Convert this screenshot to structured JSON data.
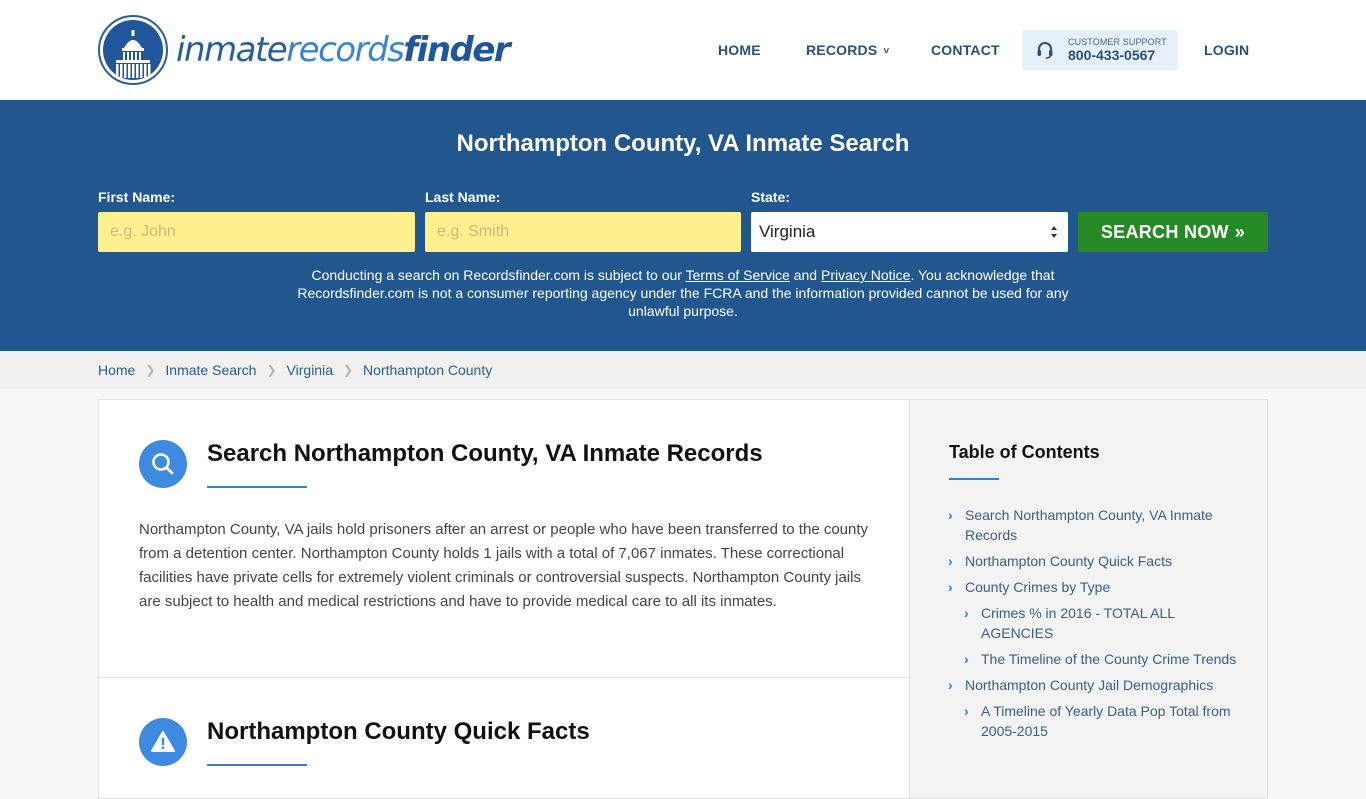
{
  "header": {
    "logo": {
      "part1": "inmate",
      "part2": "records",
      "part3": "finder"
    },
    "nav": {
      "home": "HOME",
      "records": "RECORDS",
      "contact": "CONTACT",
      "login": "LOGIN"
    },
    "support": {
      "label": "CUSTOMER SUPPORT",
      "phone": "800-433-0567"
    }
  },
  "hero": {
    "title": "Northampton County, VA Inmate Search",
    "first_name_label": "First Name:",
    "first_name_placeholder": "e.g. John",
    "first_name_value": "",
    "last_name_label": "Last Name:",
    "last_name_placeholder": "e.g. Smith",
    "last_name_value": "",
    "state_label": "State:",
    "state_value": "Virginia",
    "search_button": "SEARCH NOW",
    "disclaimer": {
      "part1": "Conducting a search on Recordsfinder.com is subject to our ",
      "terms_link": "Terms of Service",
      "part2": " and ",
      "privacy_link": "Privacy Notice",
      "part3": ". You acknowledge that Recordsfinder.com is not a consumer reporting agency under the FCRA and the information provided cannot be used for any unlawful purpose."
    }
  },
  "breadcrumb": {
    "items": [
      "Home",
      "Inmate Search",
      "Virginia",
      "Northampton County"
    ]
  },
  "main": {
    "sections": [
      {
        "icon": "search-icon",
        "title": "Search Northampton County, VA Inmate Records",
        "body": "Northampton County, VA jails hold prisoners after an arrest or people who have been transferred to the county from a detention center. Northampton County holds 1 jails with a total of 7,067 inmates. These correctional facilities have private cells for extremely violent criminals or controversial suspects. Northampton County jails are subject to health and medical restrictions and have to provide medical care to all its inmates."
      },
      {
        "icon": "warning-icon",
        "title": "Northampton County Quick Facts"
      }
    ]
  },
  "toc": {
    "title": "Table of Contents",
    "items": [
      {
        "label": "Search Northampton County, VA Inmate Records",
        "level": 1
      },
      {
        "label": "Northampton County Quick Facts",
        "level": 1
      },
      {
        "label": "County Crimes by Type",
        "level": 1
      },
      {
        "label": "Crimes % in 2016 - TOTAL ALL AGENCIES",
        "level": 2
      },
      {
        "label": "The Timeline of the County Crime Trends",
        "level": 2
      },
      {
        "label": "Northampton County Jail Demographics",
        "level": 1
      },
      {
        "label": "A Timeline of Yearly Data Pop Total from 2005-2015",
        "level": 2
      }
    ]
  },
  "colors": {
    "brand_blue": "#22568f",
    "accent_blue": "#3d8ae0",
    "input_yellow": "#fff08f",
    "search_green": "#258a26"
  }
}
